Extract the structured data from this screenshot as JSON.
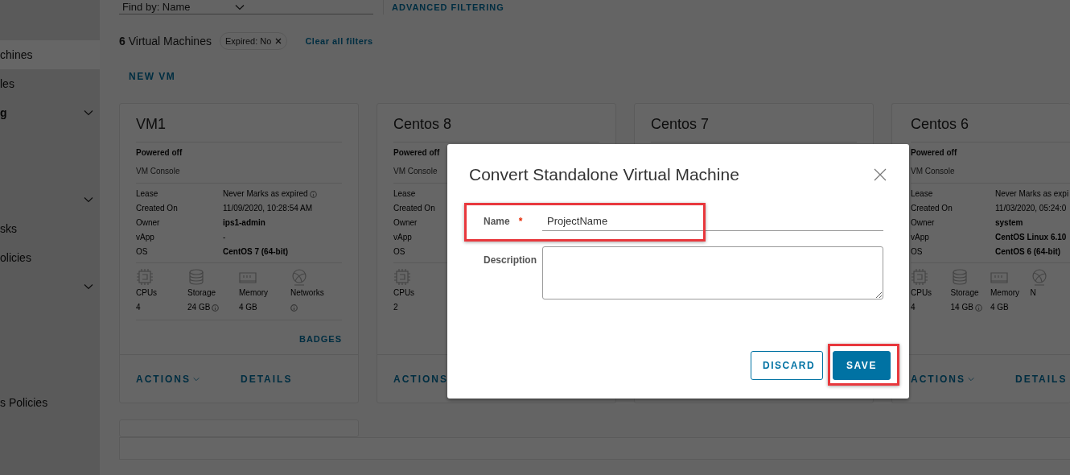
{
  "sidebar": {
    "items": [
      {
        "label": "chines",
        "selected": true,
        "expandable": false
      },
      {
        "label": "les",
        "selected": false,
        "expandable": false
      },
      {
        "label": "g",
        "selected": false,
        "expandable": true,
        "bold": true
      },
      {
        "selected": false,
        "expandable": true
      },
      {
        "label": "sks",
        "selected": false,
        "expandable": false
      },
      {
        "label": "olicies",
        "selected": false,
        "expandable": false
      },
      {
        "selected": false,
        "expandable": true
      },
      {
        "label": "s Policies",
        "selected": false,
        "expandable": false
      }
    ]
  },
  "filter_bar": {
    "find_by_label": "Find by:",
    "find_by_value": "Name",
    "advanced_link": "ADVANCED FILTERING"
  },
  "summary": {
    "count": "6",
    "noun": "Virtual Machines",
    "chips": [
      {
        "label": "Expired: No"
      }
    ],
    "clear_link": "Clear all filters"
  },
  "new_button": "NEW VM",
  "cards": [
    {
      "title": "VM1",
      "status": "Powered off",
      "console": "VM Console",
      "details": [
        {
          "label": "Lease",
          "value": "Never Marks as expired",
          "info": true
        },
        {
          "label": "Created On",
          "value": "11/09/2020, 10:28:54 AM"
        },
        {
          "label": "Owner",
          "value": "ips1-admin",
          "bold": true
        },
        {
          "label": "vApp",
          "value": "-"
        },
        {
          "label": "OS",
          "value": "CentOS 7 (64-bit)",
          "bold": true
        }
      ],
      "stats": [
        {
          "kind": "cpu",
          "label": "CPUs",
          "value": "4"
        },
        {
          "kind": "storage",
          "label": "Storage",
          "value": "24 GB",
          "info": true
        },
        {
          "kind": "memory",
          "label": "Memory",
          "value": "4 GB"
        },
        {
          "kind": "network",
          "label": "Networks",
          "info": true
        }
      ],
      "badges": "BADGES",
      "actions": "ACTIONS",
      "actions_menu": true,
      "details_link": "DETAILS"
    },
    {
      "title": "Centos 8",
      "status": "Powered off",
      "console": "VM Console",
      "details": [
        {
          "label": "Lease"
        },
        {
          "label": "Created On"
        },
        {
          "label": "Owner"
        },
        {
          "label": "vApp"
        },
        {
          "label": "OS"
        }
      ],
      "stats": [
        {
          "kind": "cpu",
          "label": "CPUs",
          "value": "2"
        }
      ],
      "actions": "ACTIONS",
      "actions_menu": false
    },
    {
      "title": "Centos 7"
    },
    {
      "title": "Centos 6",
      "status": "Powered off",
      "console": "VM Console",
      "details": [
        {
          "label": "Lease",
          "value": "Never Marks as expi"
        },
        {
          "label": "Created On",
          "value": "11/03/2020, 05:24:0"
        },
        {
          "label": "Owner",
          "value": "system",
          "bold": true
        },
        {
          "label": "vApp",
          "value": "CentOS Linux 6.10",
          "bold": true
        },
        {
          "label": "OS",
          "value": "CentOS 6 (64-bit)",
          "bold": true
        }
      ],
      "stats": [
        {
          "kind": "cpu",
          "label": "CPUs",
          "value": "4"
        },
        {
          "kind": "storage",
          "label": "Storage",
          "value": "14 GB",
          "info": true
        },
        {
          "kind": "memory",
          "label": "Memory",
          "value": "4 GB"
        },
        {
          "kind": "network",
          "label": "N"
        }
      ],
      "actions": "ACTIONS",
      "actions_menu": true,
      "details_link": "DETAILS"
    }
  ],
  "modal": {
    "title": "Convert Standalone Virtual Machine",
    "fields": [
      {
        "kind": "text",
        "label": "Name",
        "required": true,
        "required_mark": "*",
        "value": "ProjectName",
        "highlighted": true
      },
      {
        "kind": "textarea",
        "label": "Description",
        "required": false,
        "highlighted": false
      }
    ],
    "buttons": [
      {
        "label": "DISCARD",
        "primary": false,
        "highlighted": false
      },
      {
        "label": "SAVE",
        "primary": true,
        "highlighted": true
      }
    ]
  }
}
